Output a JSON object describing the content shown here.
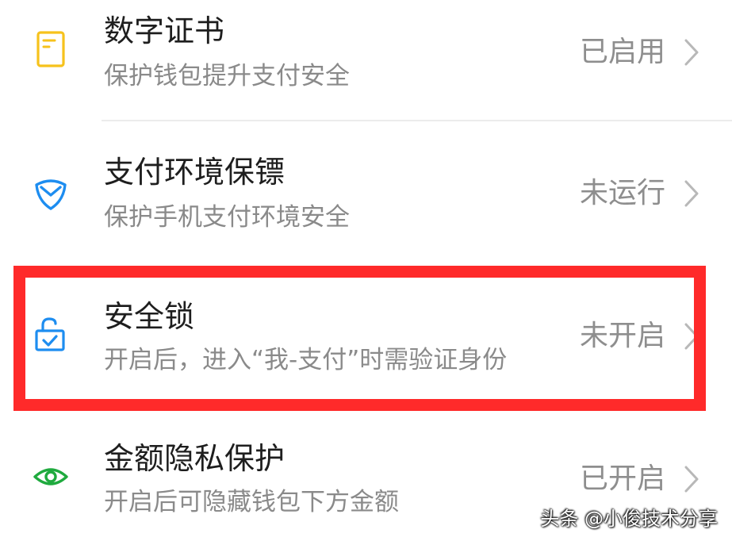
{
  "items": [
    {
      "title": "数字证书",
      "subtitle": "保护钱包提升支付安全",
      "status": "已启用",
      "icon": "certificate-icon",
      "icon_color": "#f6c21c"
    },
    {
      "title": "支付环境保镖",
      "subtitle": "保护手机支付环境安全",
      "status": "未运行",
      "icon": "shield-icon",
      "icon_color": "#1d8df0"
    },
    {
      "title": "安全锁",
      "subtitle": "开启后，进入“我-支付”时需验证身份",
      "status": "未开启",
      "icon": "lock-icon",
      "icon_color": "#1d8df0"
    },
    {
      "title": "金额隐私保护",
      "subtitle": "开启后可隐藏钱包下方金额",
      "status": "已开启",
      "icon": "eye-icon",
      "icon_color": "#1faa3e"
    }
  ],
  "highlight_color": "#ff2a2a",
  "watermark": "头条 @小俊技术分享"
}
